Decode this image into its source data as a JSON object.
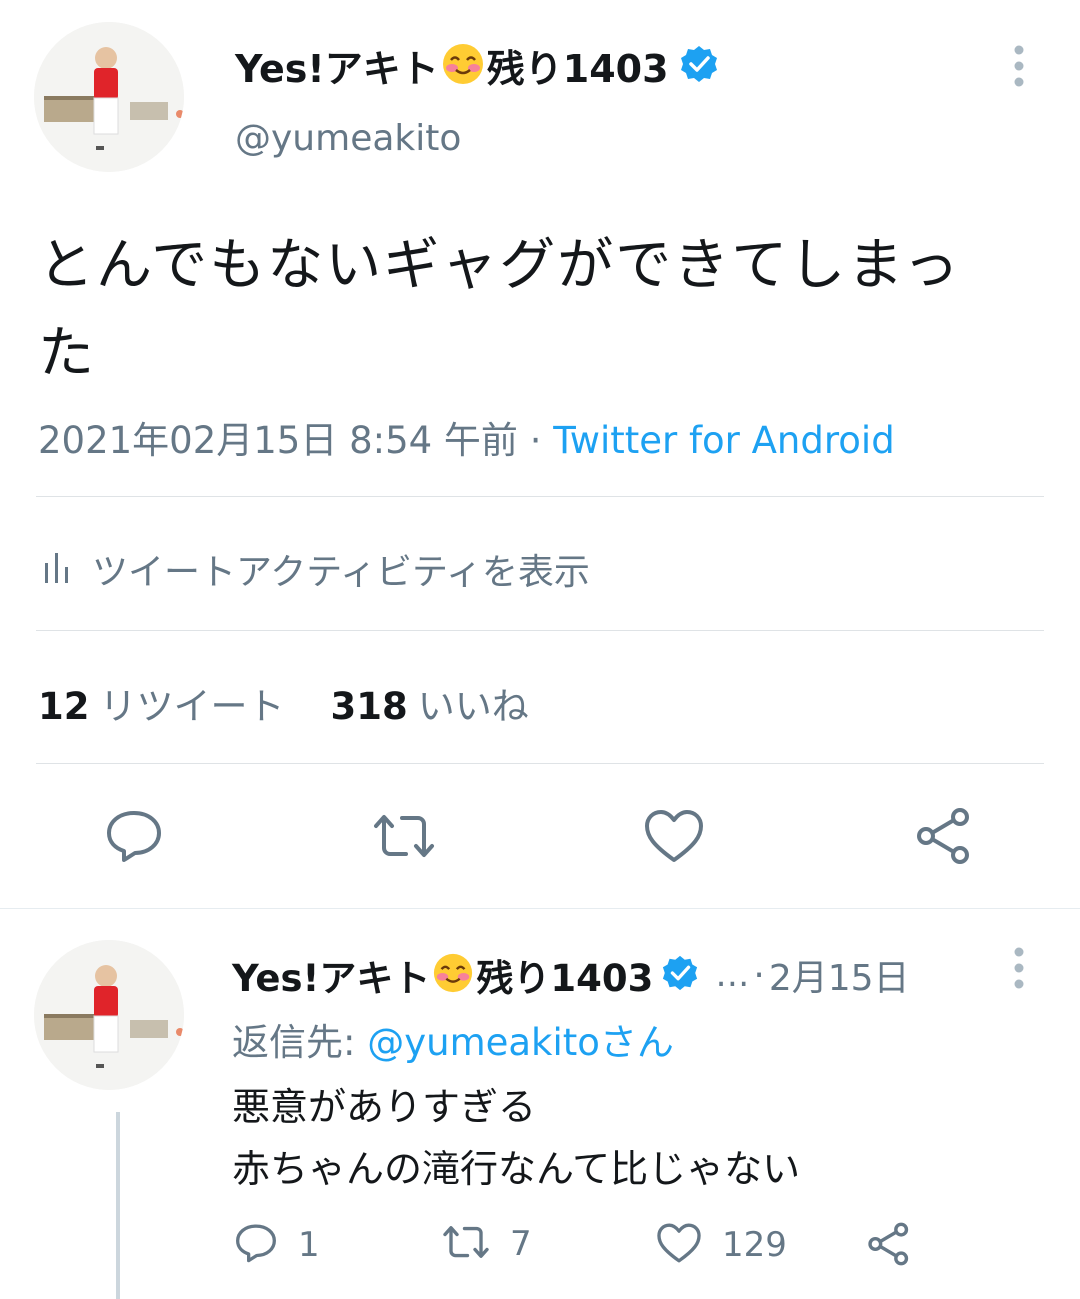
{
  "main_tweet": {
    "display_name_prefix": "Yes!アキト",
    "display_name_suffix": "残り1403",
    "handle": "@yumeakito",
    "text_line1": "とんでもないギャグができてしまっ",
    "text_line2": "た",
    "timestamp": "2021年02月15日 8:54 午前 · ",
    "source": "Twitter for Android",
    "activity_label": "ツイートアクティビティを表示",
    "retweet_count": "12",
    "retweet_label": "リツイート",
    "like_count": "318",
    "like_label": "いいね"
  },
  "reply": {
    "display_name_prefix": "Yes!アキト",
    "display_name_suffix": "残り1403",
    "ellipsis": "…",
    "separator": "·",
    "date": "2月15日",
    "reply_to_prefix": "返信先: ",
    "reply_to_mention": "@yumeakitoさん",
    "text_line1": "悪意がありすぎる",
    "text_line2": "赤ちゃんの滝行なんて比じゃない",
    "reply_count": "1",
    "retweet_count": "7",
    "like_count": "129"
  },
  "colors": {
    "accent": "#1da1f2",
    "secondary_text": "#657786",
    "primary_text": "#14171a"
  },
  "icons": [
    "verified-badge-icon",
    "smiling-face-emoji-icon",
    "more-vertical-icon",
    "bar-chart-icon",
    "reply-icon",
    "retweet-icon",
    "like-icon",
    "share-icon"
  ]
}
